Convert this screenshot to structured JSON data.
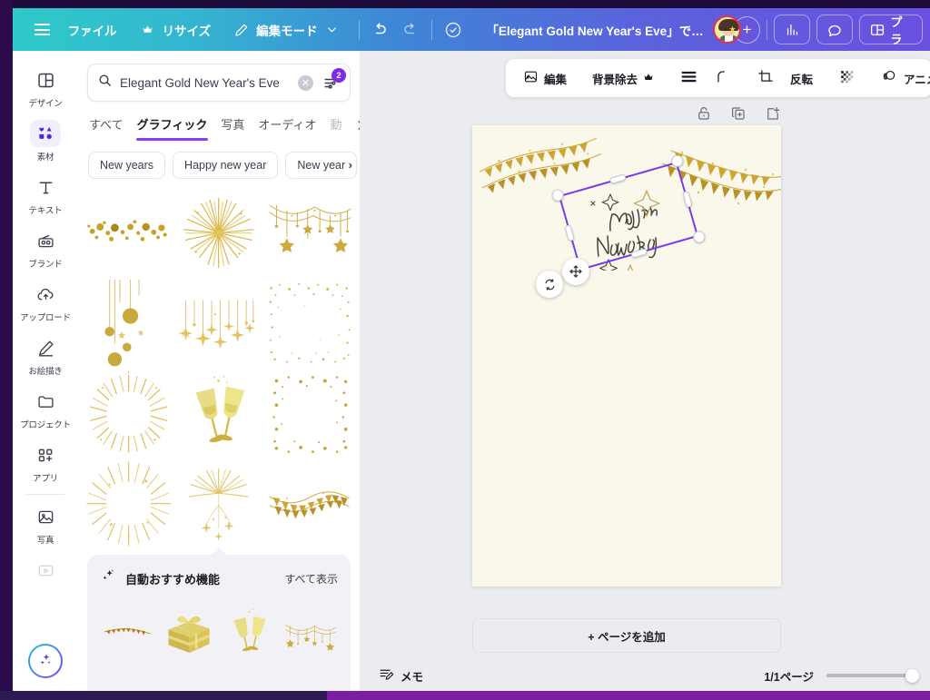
{
  "topbar": {
    "menu_icon": "hamburger-icon",
    "file_label": "ファイル",
    "resize_label": "リサイズ",
    "resize_crown_icon": "crown-icon",
    "edit_mode_label": "編集モード",
    "edit_mode_pencil_icon": "pencil-icon",
    "chevron_icon": "chevron-down-icon",
    "undo_icon": "undo-icon",
    "redo_icon": "redo-icon",
    "cloud_icon": "cloud-check-icon",
    "doc_title": "「Elegant Gold New Year's Eve」で…",
    "avatar_name": "user-avatar",
    "add_collaborator_label": "+",
    "insights_icon": "bar-chart-icon",
    "comment_icon": "comment-bubble-icon",
    "present_icon": "present-layout-icon",
    "present_label": "プラ"
  },
  "rail": {
    "items": [
      {
        "label": "デザイン",
        "icon": "design-layout-icon",
        "active": false
      },
      {
        "label": "素材",
        "icon": "elements-shapes-icon",
        "active": true
      },
      {
        "label": "テキスト",
        "icon": "text-t-icon",
        "active": false
      },
      {
        "label": "ブランド",
        "icon": "brand-radio-icon",
        "active": false
      },
      {
        "label": "アップロード",
        "icon": "upload-cloud-icon",
        "active": false
      },
      {
        "label": "お絵描き",
        "icon": "draw-pen-icon",
        "active": false
      },
      {
        "label": "プロジェクト",
        "icon": "folder-icon",
        "active": false
      },
      {
        "label": "アプリ",
        "icon": "apps-grid-plus-icon",
        "active": false
      },
      {
        "label": "写真",
        "icon": "photo-image-icon",
        "active": false
      }
    ],
    "ai_button_icon": "magic-sparkle-icon"
  },
  "panel": {
    "search": {
      "value": "Elegant Gold New Year's Eve",
      "placeholder": "検索",
      "search_icon": "search-icon",
      "clear_icon": "clear-x-icon",
      "filter_icon": "filter-sliders-icon",
      "filter_badge": "2"
    },
    "tabs": [
      {
        "label": "すべて",
        "active": false
      },
      {
        "label": "グラフィック",
        "active": true
      },
      {
        "label": "写真",
        "active": false
      },
      {
        "label": "オーディオ",
        "active": false
      },
      {
        "label": "動",
        "active": false,
        "faded": true
      }
    ],
    "tabs_next_icon": "chevron-right-icon",
    "chips": [
      "New years",
      "Happy new year",
      "New year"
    ],
    "chips_next_icon": "chevron-right-icon",
    "results": [
      {
        "name": "gold-confetti-dots",
        "kind": "dots"
      },
      {
        "name": "gold-starburst-rays",
        "kind": "burst"
      },
      {
        "name": "hanging-stars-garland",
        "kind": "garland"
      },
      {
        "name": "hanging-gold-baubles",
        "kind": "baubles"
      },
      {
        "name": "hanging-sparkle-stars",
        "kind": "sparkles"
      },
      {
        "name": "gold-glitter-frame",
        "kind": "frame"
      },
      {
        "name": "gold-sunburst",
        "kind": "sunburst"
      },
      {
        "name": "champagne-toast-glasses",
        "kind": "glasses"
      },
      {
        "name": "gold-dot-square-frame",
        "kind": "dotframe"
      },
      {
        "name": "gold-radial-sparkle",
        "kind": "radial"
      },
      {
        "name": "gold-firework",
        "kind": "firework"
      },
      {
        "name": "gold-bunting-flags",
        "kind": "bunting"
      }
    ],
    "recommend": {
      "icon": "sparkle-wand-icon",
      "title": "自動おすすめ機能",
      "show_all_label": "すべて表示",
      "items": [
        {
          "name": "gold-bunting-small",
          "kind": "bunting"
        },
        {
          "name": "gold-gift-box",
          "kind": "gift"
        },
        {
          "name": "champagne-glasses",
          "kind": "glasses"
        },
        {
          "name": "star-garland",
          "kind": "garland"
        }
      ]
    }
  },
  "context_toolbar": {
    "edit_icon": "image-edit-icon",
    "edit_label": "編集",
    "bg_remove_label": "背景除去",
    "bg_remove_crown_icon": "crown-icon",
    "stack_icon": "layers-stack-icon",
    "corner_icon": "corner-radius-icon",
    "crop_icon": "crop-icon",
    "flip_label": "反転",
    "transparency_icon": "transparency-checker-icon",
    "animate_icon": "animate-circles-icon",
    "animate_label": "アニメ…"
  },
  "page_tools": {
    "lock_icon": "lock-icon",
    "duplicate_icon": "duplicate-page-icon",
    "add_page_icon": "add-page-icon"
  },
  "canvas": {
    "background_color": "#faf8ea",
    "headline_line1": "Happy",
    "headline_line2": "New Year",
    "selection": {
      "rotate_icon": "rotate-handle-icon",
      "move_icon": "move-handle-icon",
      "selected_element": "gold-bunting-flags",
      "border_color": "#7c3aed"
    }
  },
  "footer": {
    "add_page_label": "+ ページを追加",
    "memo_icon": "notes-icon",
    "memo_label": "メモ",
    "page_count": "1/1ページ",
    "zoom_slider_name": "zoom-slider"
  },
  "colors": {
    "gradient_start": "#2ec9c9",
    "gradient_end": "#6b4fe0",
    "accent_purple": "#8b3dff",
    "badge_purple": "#7d2ae8",
    "gold": "#c9a227",
    "stage_bg": "#ebecf0"
  }
}
